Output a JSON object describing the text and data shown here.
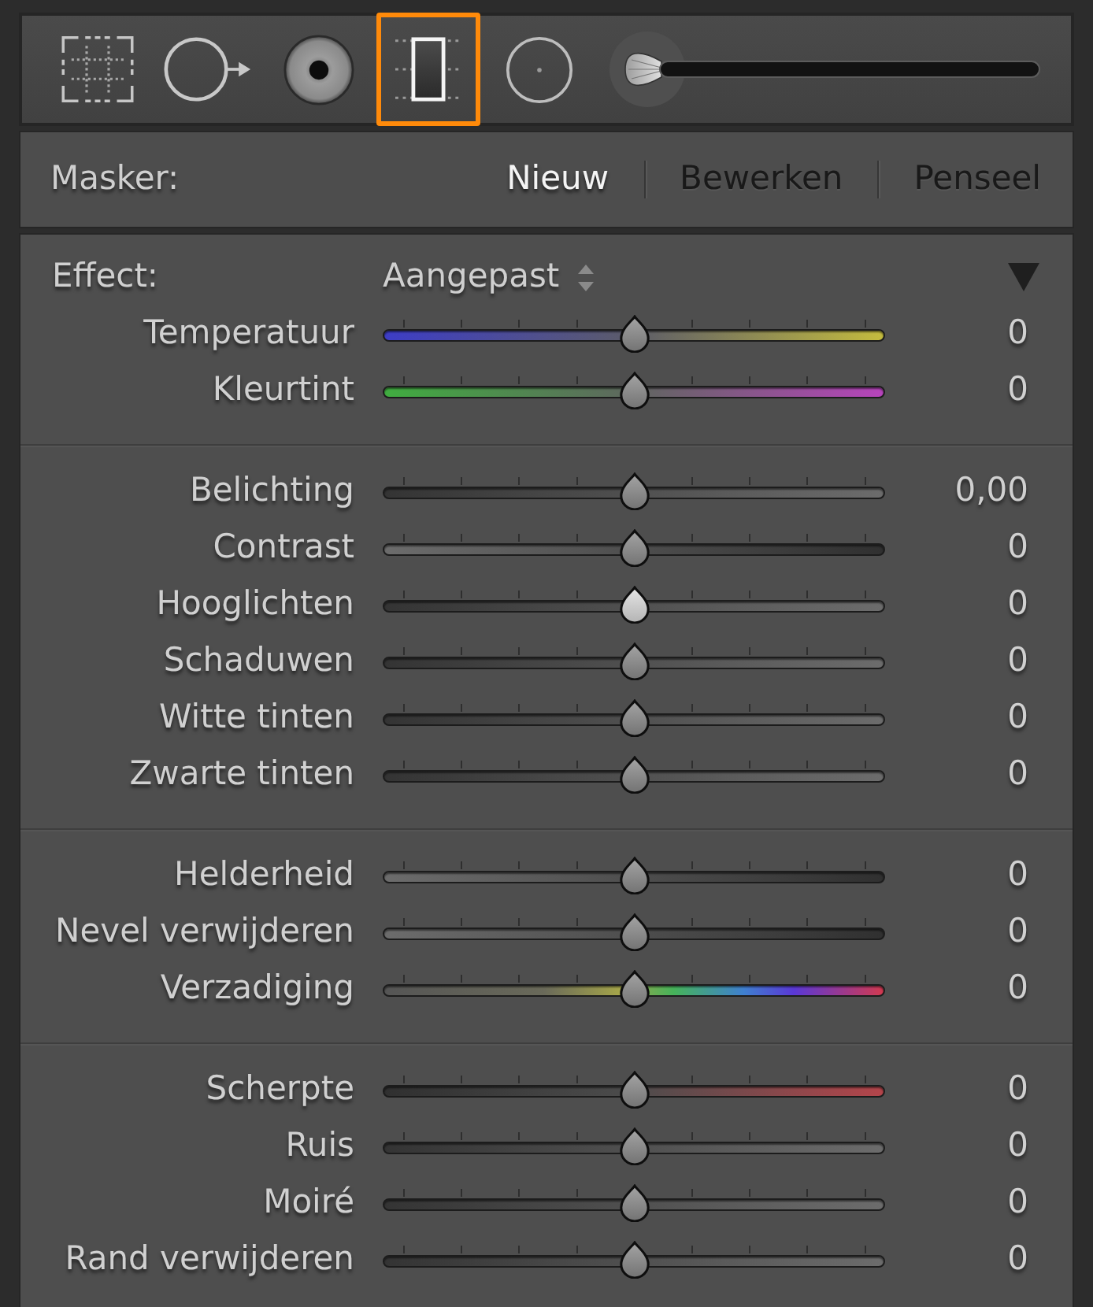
{
  "tools": [
    {
      "kind": "crop",
      "selected": false
    },
    {
      "kind": "spot",
      "selected": false
    },
    {
      "kind": "redeye",
      "selected": false
    },
    {
      "kind": "graduated",
      "selected": true
    },
    {
      "kind": "radial",
      "selected": false
    },
    {
      "kind": "brush",
      "selected": false
    }
  ],
  "mask": {
    "label": "Masker:",
    "tabs": [
      {
        "label": "Nieuw",
        "selected": true
      },
      {
        "label": "Bewerken",
        "selected": false
      },
      {
        "label": "Penseel",
        "selected": false
      }
    ]
  },
  "sections": [
    {
      "effect": {
        "label": "Effect:",
        "value": "Aangepast",
        "expanded": true
      },
      "sliders": [
        {
          "label": "Temperatuur",
          "kind": "temperature",
          "level": 0.5,
          "value": "0",
          "hovered": false
        },
        {
          "label": "Kleurtint",
          "kind": "tint",
          "level": 0.5,
          "value": "0",
          "hovered": false
        }
      ]
    },
    {
      "sliders": [
        {
          "label": "Belichting",
          "kind": "rising",
          "level": 0.5,
          "value": "0,00",
          "hovered": false
        },
        {
          "label": "Contrast",
          "kind": "falling",
          "level": 0.5,
          "value": "0",
          "hovered": false
        },
        {
          "label": "Hooglichten",
          "kind": "rising",
          "level": 0.5,
          "value": "0",
          "hovered": true
        },
        {
          "label": "Schaduwen",
          "kind": "rising",
          "level": 0.5,
          "value": "0",
          "hovered": false
        },
        {
          "label": "Witte tinten",
          "kind": "rising",
          "level": 0.5,
          "value": "0",
          "hovered": false
        },
        {
          "label": "Zwarte tinten",
          "kind": "rising",
          "level": 0.5,
          "value": "0",
          "hovered": false
        }
      ]
    },
    {
      "sliders": [
        {
          "label": "Helderheid",
          "kind": "falling",
          "level": 0.5,
          "value": "0",
          "hovered": false
        },
        {
          "label": "Nevel verwijderen",
          "kind": "falling",
          "level": 0.5,
          "value": "0",
          "hovered": false
        },
        {
          "label": "Verzadiging",
          "kind": "saturation",
          "level": 0.5,
          "value": "0",
          "hovered": false
        }
      ]
    },
    {
      "sliders": [
        {
          "label": "Scherpte",
          "kind": "sharpness",
          "level": 0.5,
          "value": "0",
          "hovered": false
        },
        {
          "label": "Ruis",
          "kind": "rising",
          "level": 0.5,
          "value": "0",
          "hovered": false
        },
        {
          "label": "Moiré",
          "kind": "rising",
          "level": 0.5,
          "value": "0",
          "hovered": false
        },
        {
          "label": "Rand verwijderen",
          "kind": "rising",
          "level": 0.5,
          "value": "0",
          "hovered": false
        }
      ]
    }
  ]
}
